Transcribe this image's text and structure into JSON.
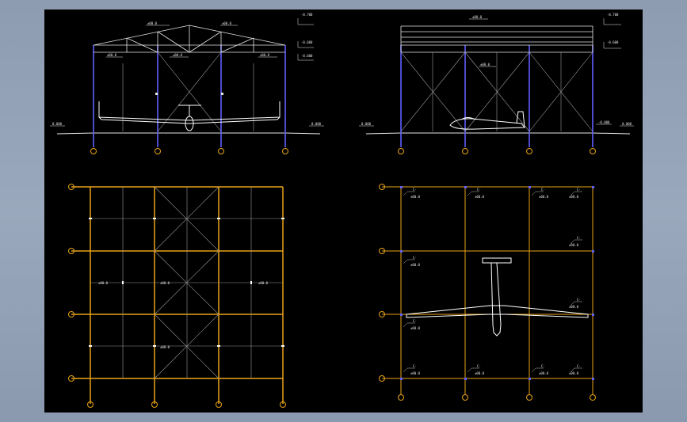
{
  "colors": {
    "background": "#000000",
    "frame": "#93a1b7",
    "columns_orange": "#e8a317",
    "columns_blue": "#5a5cff",
    "lines_white": "#e6e6e6",
    "lines_gray": "#9a9a9a"
  },
  "views": {
    "front_elevation": {
      "elev_labels": [
        "-0.700",
        "-0.600",
        "-0.600"
      ],
      "level_labels": [
        "0.000",
        "0.000"
      ],
      "dim_labels": [
        "±00.0",
        "±00.0",
        "±00.0",
        "±00.0",
        "±00.0"
      ]
    },
    "side_elevation": {
      "elev_labels": [
        "-0.700",
        "-0.600"
      ],
      "level_labels": [
        "0.000",
        "-0.000",
        "0.000"
      ],
      "dim_labels": [
        "±00.0",
        "±00.0"
      ]
    },
    "roof_plan": {
      "dim_labels": [
        "±00.0",
        "±00.0",
        "±00.0",
        "±00.0"
      ]
    },
    "floor_plan": {
      "col_tag": "C-",
      "dim_label": "±00.0"
    }
  }
}
